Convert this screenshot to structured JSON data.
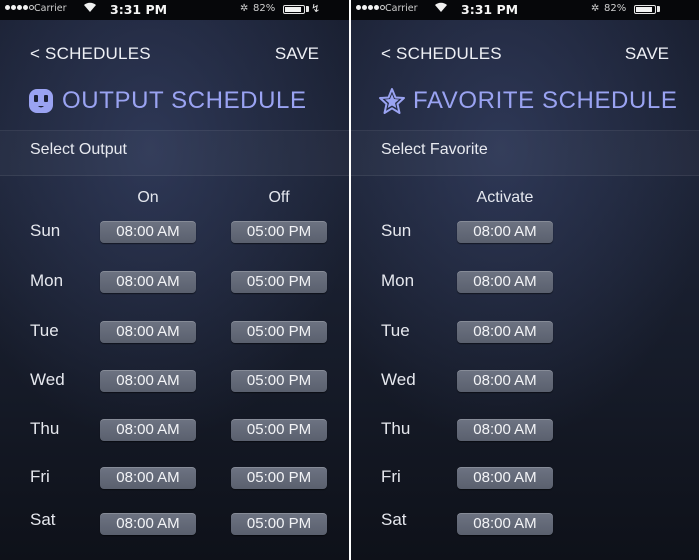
{
  "left": {
    "status": {
      "carrier": "Carrier",
      "time": "3:31 PM",
      "battery": "82%",
      "wifi_icon": "wifi-icon"
    },
    "nav": {
      "back": "< SCHEDULES",
      "save": "SAVE"
    },
    "title": "OUTPUT SCHEDULE",
    "title_icon": "outlet-icon",
    "select_label": "Select Output",
    "columns": [
      "On",
      "Off"
    ],
    "rows": [
      {
        "day": "Sun",
        "on": "08:00 AM",
        "off": "05:00 PM"
      },
      {
        "day": "Mon",
        "on": "08:00 AM",
        "off": "05:00 PM"
      },
      {
        "day": "Tue",
        "on": "08:00 AM",
        "off": "05:00 PM"
      },
      {
        "day": "Wed",
        "on": "08:00 AM",
        "off": "05:00 PM"
      },
      {
        "day": "Thu",
        "on": "08:00 AM",
        "off": "05:00 PM"
      },
      {
        "day": "Fri",
        "on": "08:00 AM",
        "off": "05:00 PM"
      },
      {
        "day": "Sat",
        "on": "08:00 AM",
        "off": "05:00 PM"
      }
    ]
  },
  "right": {
    "status": {
      "carrier": "Carrier",
      "time": "3:31 PM",
      "battery": "82%",
      "wifi_icon": "wifi-icon"
    },
    "nav": {
      "back": "< SCHEDULES",
      "save": "SAVE"
    },
    "title": "FAVORITE SCHEDULE",
    "title_icon": "star-icon",
    "select_label": "Select Favorite",
    "columns": [
      "Activate"
    ],
    "rows": [
      {
        "day": "Sun",
        "activate": "08:00 AM"
      },
      {
        "day": "Mon",
        "activate": "08:00 AM"
      },
      {
        "day": "Tue",
        "activate": "08:00 AM"
      },
      {
        "day": "Wed",
        "activate": "08:00 AM"
      },
      {
        "day": "Thu",
        "activate": "08:00 AM"
      },
      {
        "day": "Fri",
        "activate": "08:00 AM"
      },
      {
        "day": "Sat",
        "activate": "08:00 AM"
      }
    ]
  },
  "colors": {
    "accent": "#9aa3f2",
    "pill": "#636977",
    "background": "#1b2134"
  }
}
